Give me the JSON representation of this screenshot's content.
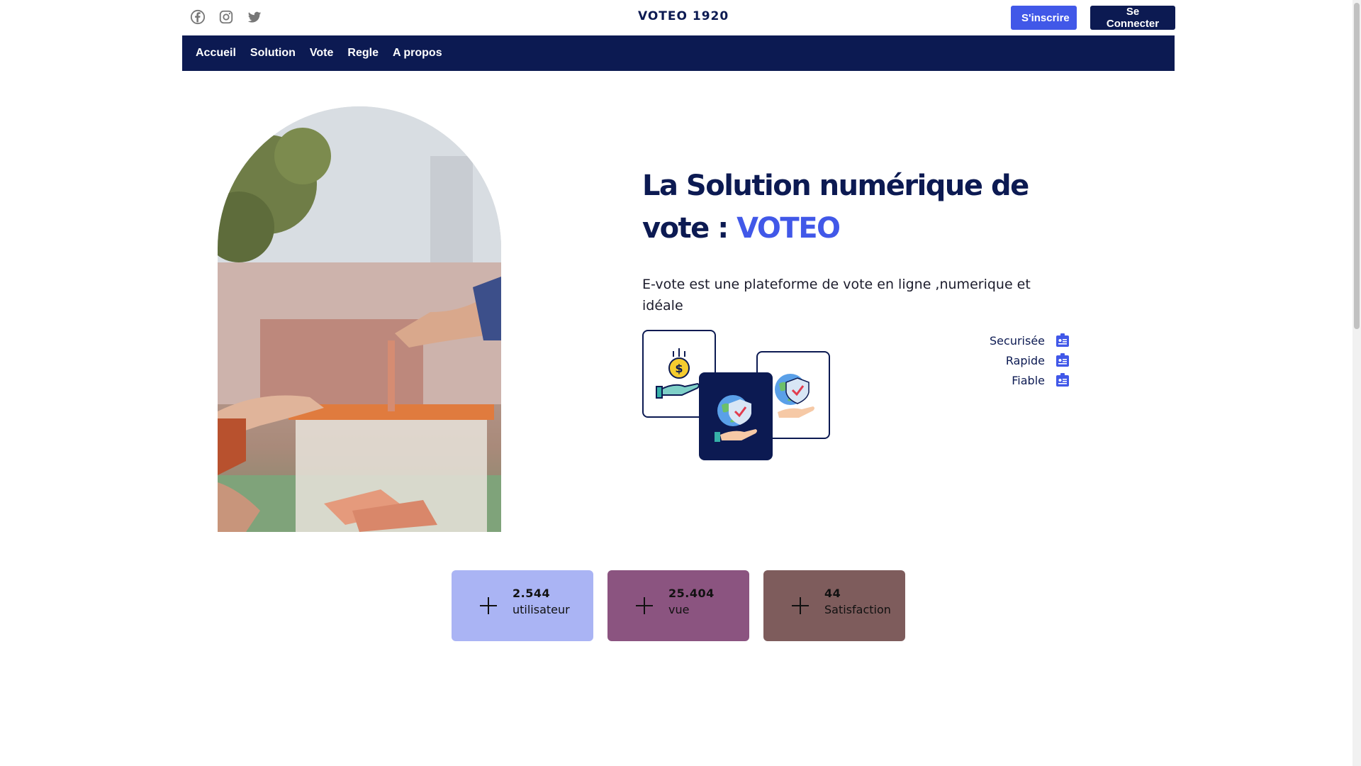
{
  "header": {
    "brand": "VOTEO 1920",
    "signup_label": "S'inscrire",
    "login_label": "Se Connecter",
    "socials": [
      "facebook-icon",
      "instagram-icon",
      "twitter-icon"
    ]
  },
  "nav": {
    "items": [
      {
        "label": "Accueil"
      },
      {
        "label": "Solution"
      },
      {
        "label": "Vote"
      },
      {
        "label": "Regle"
      },
      {
        "label": "A propos"
      }
    ]
  },
  "hero": {
    "title_prefix": "La Solution numérique de vote : ",
    "title_accent": "VOTEO",
    "description": "E-vote est une plateforme de vote en ligne ,numerique et idéale",
    "image_icon": "ballot-box-photo"
  },
  "features": [
    {
      "label": "Securisée",
      "icon": "id-badge-icon"
    },
    {
      "label": "Rapide",
      "icon": "id-badge-icon"
    },
    {
      "label": "Fiable",
      "icon": "id-badge-icon"
    }
  ],
  "stats": [
    {
      "value": "2.544",
      "label": "utilisateur",
      "color": "#aab4f4"
    },
    {
      "value": "25.404",
      "label": "vue",
      "color": "#8b5480"
    },
    {
      "value": "44",
      "label": "Satisfaction",
      "color": "#7e5c5c"
    }
  ],
  "colors": {
    "primary": "#0c1a52",
    "accent": "#4158e8"
  }
}
